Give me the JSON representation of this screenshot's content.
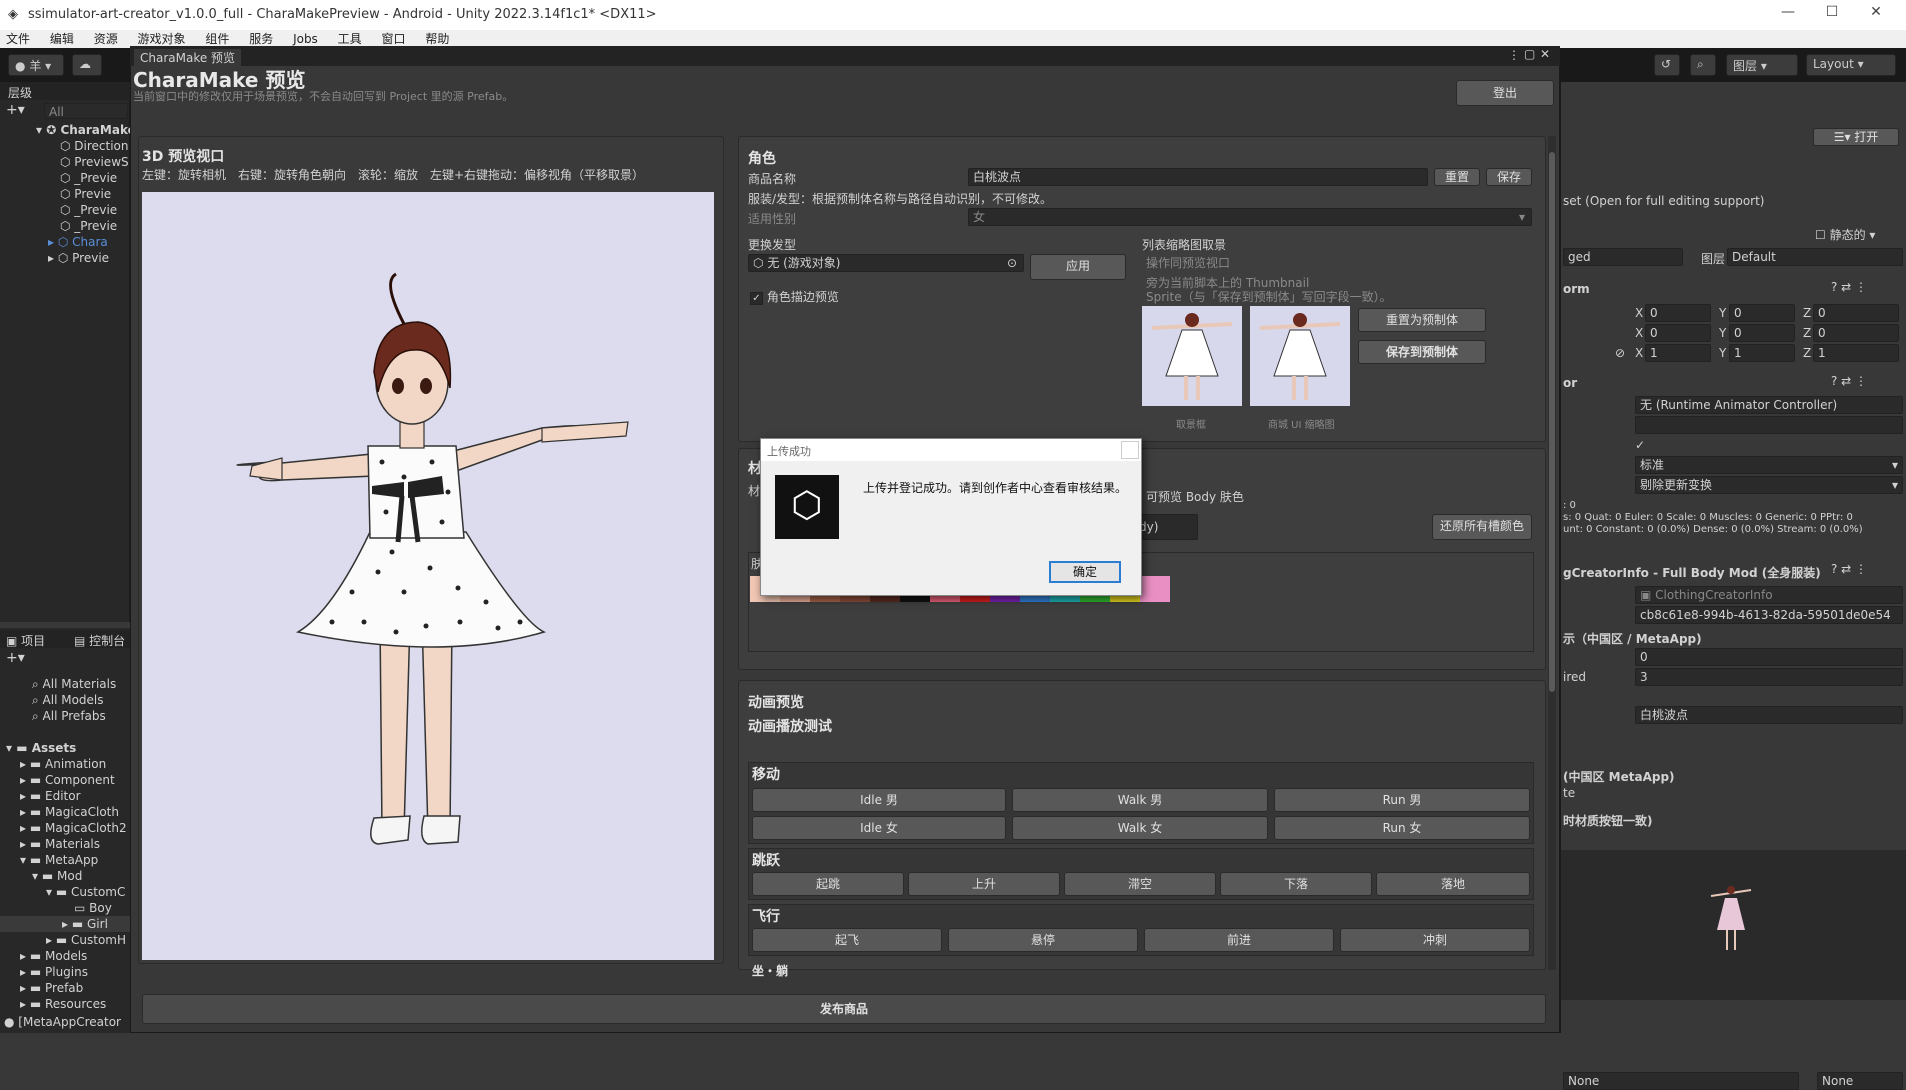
{
  "window_title": "ssimulator-art-creator_v1.0.0_full - CharaMakePreview - Android - Unity 2022.3.14f1c1* <DX11>",
  "menu": [
    "文件",
    "编辑",
    "资源",
    "游戏对象",
    "组件",
    "服务",
    "Jobs",
    "工具",
    "窗口",
    "帮助"
  ],
  "toolbar": {
    "account": "羊",
    "layers_label": "图层",
    "layout_label": "Layout"
  },
  "hierarchy": {
    "tab": "层级",
    "search_placeholder": "All",
    "items": [
      "CharaMake",
      "Direction",
      "PreviewS",
      "_Previe",
      "Previe",
      "_Previe",
      "_Previe",
      "Chara",
      "Previe"
    ]
  },
  "project": {
    "tab_project": "项目",
    "tab_console": "控制台",
    "favorites": [
      "All Materials",
      "All Models",
      "All Prefabs"
    ],
    "assets_label": "Assets",
    "folders": [
      "Animation",
      "Component",
      "Editor",
      "MagicaCloth",
      "MagicaCloth2",
      "Materials",
      "MetaApp",
      "Mod",
      "CustomC",
      "Boy",
      "Girl",
      "CustomH",
      "Models",
      "Plugins",
      "Prefab",
      "Resources"
    ],
    "status": "[MetaAppCreator"
  },
  "preview_window": {
    "tab": "CharaMake 预览",
    "title": "CharaMake 预览",
    "subtitle": "当前窗口中的修改仅用于场景预览，不会自动回写到 Project 里的源 Prefab。",
    "logout": "登出",
    "viewport_title": "3D 预览视口",
    "viewport_hint": "左键：旋转相机　右键：旋转角色朝向　滚轮：缩放　左键+右键拖动：偏移视角（平移取景）",
    "publish": "发布商品"
  },
  "role": {
    "header": "角色",
    "name_label": "商品名称",
    "name_value": "白桃波点",
    "reset": "重置",
    "save": "保存",
    "note": "服装/发型：根据预制体名称与路径自动识别，不可修改。",
    "gender_label": "适用性别",
    "gender_value": "女",
    "hair_label": "更换发型",
    "hair_value": "无 (游戏对象)",
    "apply": "应用",
    "outline_label": "角色描边预览",
    "thumb_label": "列表缩略图取景",
    "thumb_sub": "操作同预览视口",
    "thumb_note1": "旁为当前脚本上的 Thumbnail",
    "thumb_note2": "Sprite（与「保存到预制体」写回字段一致）。",
    "reset_prefab": "重置为预制体",
    "save_prefab": "保存到预制体",
    "cap1": "取景框",
    "cap2": "商城 UI 缩略图"
  },
  "material": {
    "header": "材",
    "sub": "材",
    "preview_body": "可预览 Body 肤色",
    "body_value": "dy)",
    "restore": "还原所有槽颜色",
    "skin_label": "肤"
  },
  "swatches": [
    "#f2c7b4",
    "#e3ab95",
    "#a4624a",
    "#8a4b39",
    "#5a2b22",
    "#111111",
    "#e8607a",
    "#d71e1e",
    "#7a23b4",
    "#2f7fd6",
    "#1eb3b3",
    "#2fb52f",
    "#e0d21e",
    "#e98fc3"
  ],
  "animation": {
    "header": "动画预览",
    "sub": "动画播放测试",
    "move": "移动",
    "move_btns": [
      "Idle 男",
      "Walk 男",
      "Run 男",
      "Idle 女",
      "Walk 女",
      "Run 女"
    ],
    "jump": "跳跃",
    "jump_btns": [
      "起跳",
      "上升",
      "滞空",
      "下落",
      "落地"
    ],
    "fly": "飞行",
    "fly_btns": [
      "起飞",
      "悬停",
      "前进",
      "冲刺"
    ],
    "more": "坐・躺"
  },
  "dialog": {
    "title": "上传成功",
    "message": "上传并登记成功。请到创作者中心查看审核结果。",
    "ok": "确定"
  },
  "inspector": {
    "open": "打开",
    "open_note": "set (Open for full editing support)",
    "static": "静态的",
    "tag": "ged",
    "layer_label": "图层",
    "layer_value": "Default",
    "transform": "orm",
    "pos": [
      "0",
      "0",
      "0"
    ],
    "rot": [
      "0",
      "0",
      "0"
    ],
    "scale": [
      "1",
      "1",
      "1"
    ],
    "animator": "or",
    "controller": "无 (Runtime Animator Controller)",
    "cull": "标准",
    "update": "剔除更新变换",
    "stats1": "s: 0 Quat: 0 Euler: 0 Scale: 0 Muscles: 0 Generic: 0 PPtr: 0",
    "stats2": "unt: 0 Constant: 0 (0.0%) Dense: 0 (0.0%) Stream: 0 (0.0%)",
    "stats0": ": 0",
    "component": "gCreatorInfo - Full Body Mod (全身服装)",
    "script": "ClothingCreatorInfo",
    "guid": "cb8c61e8-994b-4613-82da-59501de0e54",
    "region": "示（中国区 / MetaApp)",
    "f1": "0",
    "required_label": "ired",
    "f2": "3",
    "name": "白桃波点",
    "region2": "(中国区 MetaApp)",
    "te": "te",
    "cut": "时材质按钮一致)",
    "none1": "None",
    "none2": "None"
  }
}
